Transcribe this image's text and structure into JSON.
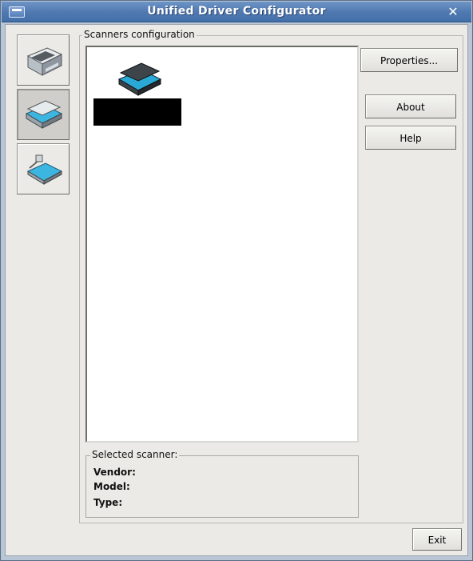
{
  "window": {
    "title": "Unified Driver Configurator",
    "menu_icon": "window-menu-icon",
    "close_glyph": "✕"
  },
  "sidebar": {
    "tabs": [
      {
        "id": "printers",
        "icon": "printer-icon",
        "active": false
      },
      {
        "id": "scanners",
        "icon": "scanner-icon",
        "active": true
      },
      {
        "id": "ports",
        "icon": "port-icon",
        "active": false
      }
    ]
  },
  "scanners_config": {
    "group_title": "Scanners configuration",
    "items": [
      {
        "icon": "scanner-icon",
        "label": ""
      }
    ]
  },
  "buttons": {
    "properties": "Properties...",
    "about": "About",
    "help": "Help",
    "exit": "Exit"
  },
  "selected_scanner": {
    "group_title": "Selected scanner:",
    "vendor_label": "Vendor:",
    "model_label": "Model:",
    "type_label": "Type:"
  },
  "colors": {
    "titlebar": "#4f78b0",
    "window_bg": "#ebeae6",
    "list_bg": "#ffffff",
    "scanner_accent": "#2aa9d6"
  }
}
